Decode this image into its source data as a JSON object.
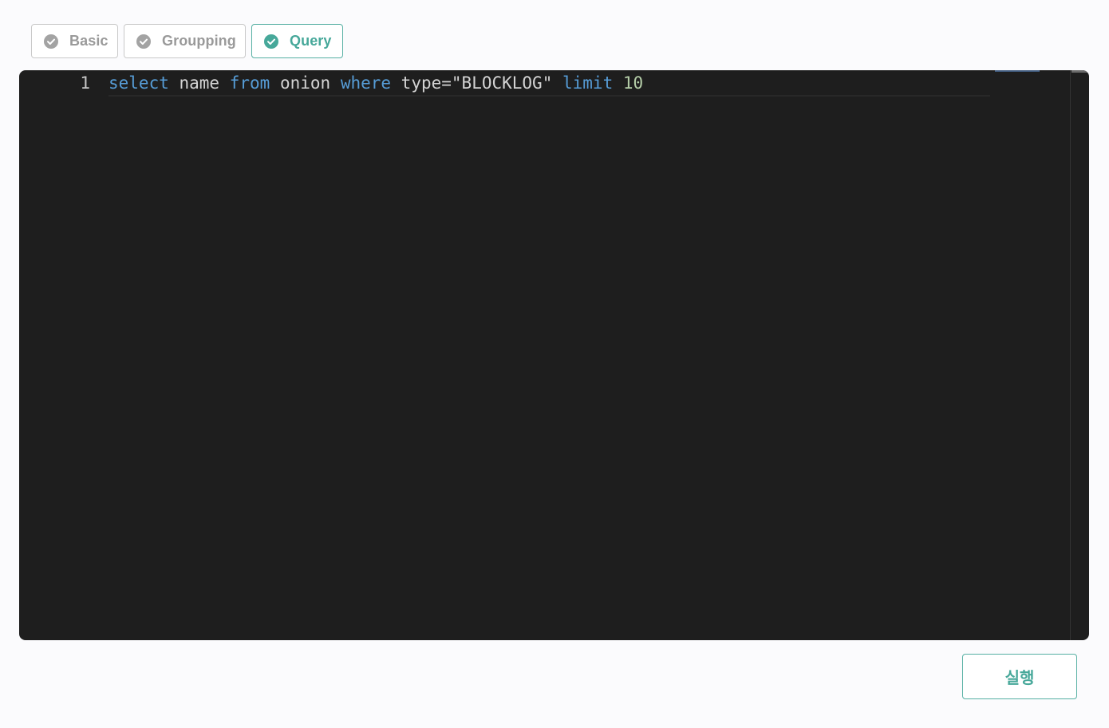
{
  "tabs": [
    {
      "label": "Basic",
      "icon": "check-circle-icon",
      "active": false
    },
    {
      "label": "Groupping",
      "icon": "check-circle-icon",
      "active": false
    },
    {
      "label": "Query",
      "icon": "check-circle-icon",
      "active": true
    }
  ],
  "editor": {
    "line_number": "1",
    "tokens": [
      {
        "text": "select",
        "type": "kw"
      },
      {
        "text": " name ",
        "type": "id"
      },
      {
        "text": "from",
        "type": "kw"
      },
      {
        "text": " onion ",
        "type": "id"
      },
      {
        "text": "where",
        "type": "kw"
      },
      {
        "text": " type",
        "type": "id"
      },
      {
        "text": "=",
        "type": "op"
      },
      {
        "text": "\"BLOCKLOG\"",
        "type": "str"
      },
      {
        "text": " ",
        "type": "id"
      },
      {
        "text": "limit",
        "type": "kw"
      },
      {
        "text": " ",
        "type": "id"
      },
      {
        "text": "10",
        "type": "num"
      }
    ]
  },
  "run_button": {
    "label": "실행"
  },
  "colors": {
    "accent": "#47a89a",
    "inactive": "#9a9a9a",
    "editor_bg": "#1e1e1e",
    "keyword": "#569cd6",
    "number": "#b5cea8"
  }
}
